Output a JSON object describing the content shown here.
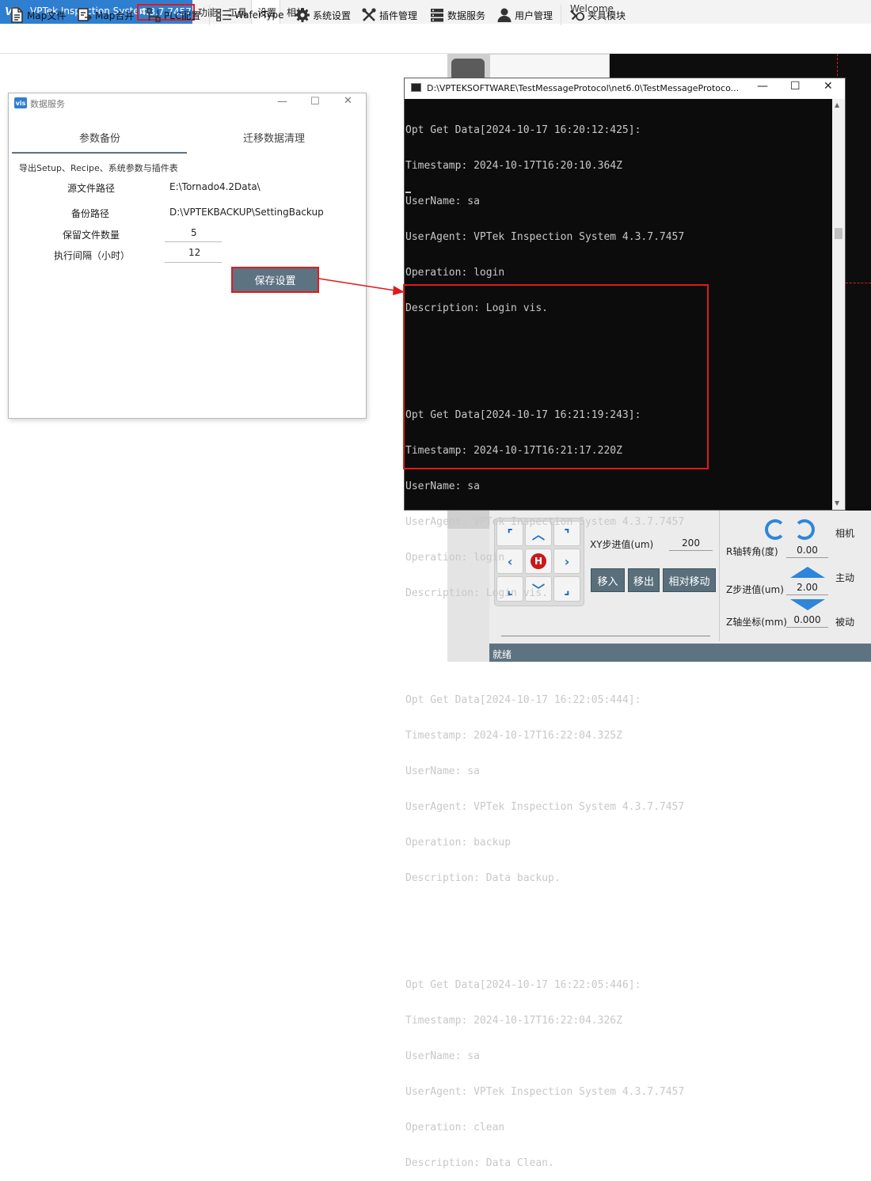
{
  "app": {
    "name": "VPTek Inspection System",
    "version": "4.3.7.7457",
    "welcome": "Welcome",
    "menu": [
      "功能",
      "工具",
      "设置",
      "相机"
    ],
    "active_menu": "设置"
  },
  "toolbar": {
    "items": [
      "Map文件",
      "Map合并",
      "PLC配置",
      "WaferType",
      "系统设置",
      "插件管理",
      "数据服务",
      "用户管理",
      "夹具模块"
    ]
  },
  "dialog": {
    "title": "数据服务",
    "tabs": [
      "参数备份",
      "迁移数据清理"
    ],
    "active_tab": "参数备份",
    "description": "导出Setup、Recipe、系统参数与插件表",
    "fields": {
      "source_label": "源文件路径",
      "source_value": "E:\\Tornado4.2Data\\",
      "backup_label": "备份路径",
      "backup_value": "D:\\VPTEKBACKUP\\SettingBackup",
      "keep_label": "保留文件数量",
      "keep_value": "5",
      "interval_label": "执行间隔（小时）",
      "interval_value": "12"
    },
    "save_label": "保存设置"
  },
  "console": {
    "title": "D:\\VPTEKSOFTWARE\\TestMessageProtocol\\net6.0\\TestMessageProtoco...",
    "entries": [
      {
        "header": "Opt Get Data[2024-10-17 16:20:12:425]:",
        "timestamp": "Timestamp: 2024-10-17T16:20:10.364Z",
        "username": "UserName: sa",
        "useragent": "UserAgent: VPTek Inspection System 4.3.7.7457",
        "operation": "Operation: login",
        "description": "Description: Login vis."
      },
      {
        "header": "Opt Get Data[2024-10-17 16:21:19:243]:",
        "timestamp": "Timestamp: 2024-10-17T16:21:17.220Z",
        "username": "UserName: sa",
        "useragent": "UserAgent: VPTek Inspection System 4.3.7.7457",
        "operation": "Operation: login",
        "description": "Description: Login vis."
      },
      {
        "header": "Opt Get Data[2024-10-17 16:22:05:444]:",
        "timestamp": "Timestamp: 2024-10-17T16:22:04.325Z",
        "username": "UserName: sa",
        "useragent": "UserAgent: VPTek Inspection System 4.3.7.7457",
        "operation": "Operation: backup",
        "description": "Description: Data backup."
      },
      {
        "header": "Opt Get Data[2024-10-17 16:22:05:446]:",
        "timestamp": "Timestamp: 2024-10-17T16:22:04.326Z",
        "username": "UserName: sa",
        "useragent": "UserAgent: VPTek Inspection System 4.3.7.7457",
        "operation": "Operation: clean",
        "description": "Description: Data Clean."
      }
    ]
  },
  "motion": {
    "xy_step_label": "XY步进值(um)",
    "xy_step_value": "200",
    "move_in": "移入",
    "move_out": "移出",
    "relative_move": "相对移动",
    "r_angle_label": "R轴转角(度)",
    "r_angle_value": "0.00",
    "z_step_label": "Z步进值(um)",
    "z_step_value": "2.00",
    "z_coord_label": "Z轴坐标(mm)",
    "z_coord_value": "0.000",
    "camera_label": "相机",
    "active_label": "主动",
    "passive_label": "被动",
    "home_label": "H"
  },
  "status": {
    "text": "就绪"
  },
  "colors": {
    "brand_blue": "#2f7fd1",
    "highlight_red": "#e01b1b",
    "button_slate": "#5e7382",
    "console_bg": "#0c0c0c"
  }
}
